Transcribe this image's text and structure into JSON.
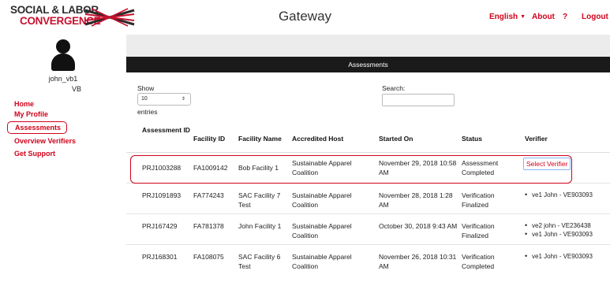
{
  "header": {
    "logo_line1": "SOCIAL & LABOR",
    "logo_line2": "CONVERGENCE",
    "app_title": "Gateway",
    "language": "English",
    "about": "About",
    "help": "?",
    "logout": "Logout"
  },
  "user": {
    "username": "john_vb1",
    "initials": "VB"
  },
  "sidebar": {
    "items": [
      {
        "label": "Home"
      },
      {
        "label": "My Profile"
      },
      {
        "label": "Assessments"
      },
      {
        "label": "Overview Verifiers"
      },
      {
        "label": "Get Support"
      }
    ]
  },
  "section_title": "Assessments",
  "controls": {
    "show_label": "Show",
    "page_size": "10",
    "entries_label": "entries",
    "search_label": "Search:",
    "search_value": ""
  },
  "table": {
    "headers": [
      "Assessment ID",
      "Facility ID",
      "Facility Name",
      "Accredited Host",
      "Started On",
      "Status",
      "Verifier"
    ],
    "rows": [
      {
        "id": "PRJ1003288",
        "facility_id": "FA1009142",
        "facility_name": "Bob Facility 1",
        "host": "Sustainable Apparel Coalition",
        "started": "November 29, 2018 10:58 AM",
        "status": "Assessment Completed",
        "verifier_action": "Select Verifier",
        "verifiers": []
      },
      {
        "id": "PRJ1091893",
        "facility_id": "FA774243",
        "facility_name": "SAC Facility 7 Test",
        "host": "Sustainable Apparel Coalition",
        "started": "November 28, 2018 1:28 AM",
        "status": "Verification Finalized",
        "verifiers": [
          "ve1 John - VE903093"
        ]
      },
      {
        "id": "PRJ167429",
        "facility_id": "FA781378",
        "facility_name": "John Facility 1",
        "host": "Sustainable Apparel Coalition",
        "started": "October 30, 2018 9:43 AM",
        "status": "Verification Finalized",
        "verifiers": [
          "ve2 john - VE236438",
          "ve1 John - VE903093"
        ]
      },
      {
        "id": "PRJ168301",
        "facility_id": "FA108075",
        "facility_name": "SAC Facility 6 Test",
        "host": "Sustainable Apparel Coalition",
        "started": "November 26, 2018 10:31 AM",
        "status": "Verification Completed",
        "verifiers": [
          "ve1 John - VE903093"
        ]
      }
    ]
  },
  "colors": {
    "accent": "#d0021b",
    "bar": "#1a1a1a",
    "strip": "#ececec"
  }
}
